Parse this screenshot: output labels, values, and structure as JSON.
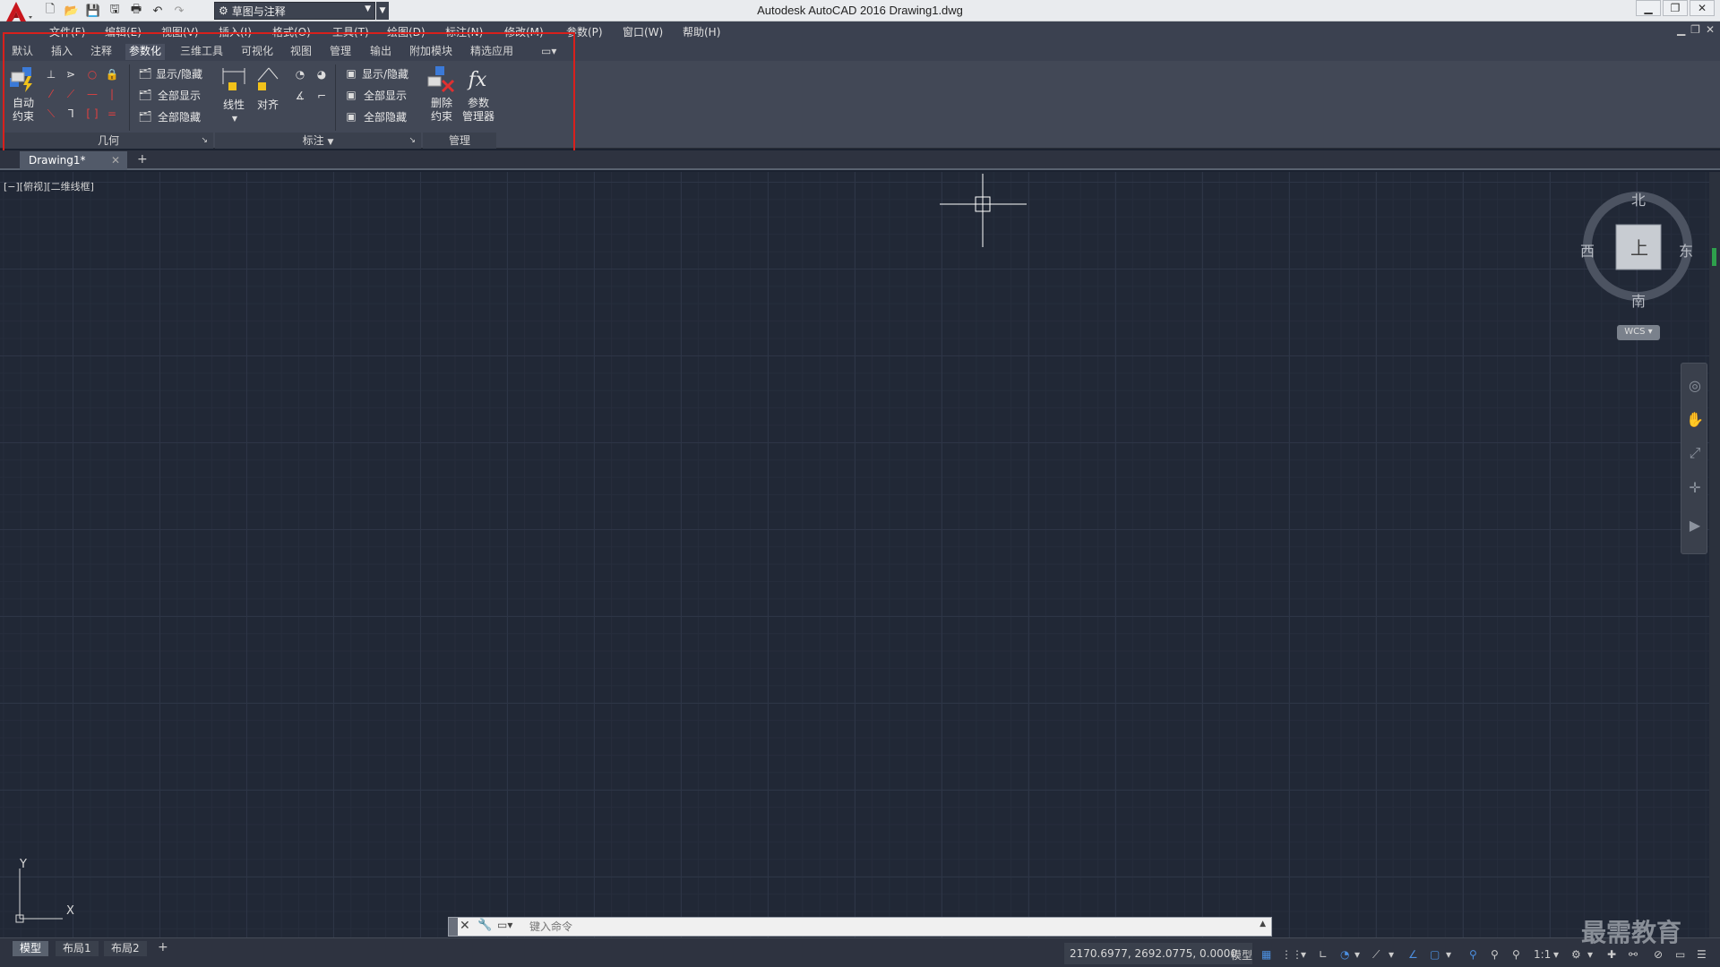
{
  "window": {
    "title": "Autodesk AutoCAD 2016    Drawing1.dwg",
    "workspace": "草图与注释"
  },
  "menu": [
    "文件(F)",
    "编辑(E)",
    "视图(V)",
    "插入(I)",
    "格式(O)",
    "工具(T)",
    "绘图(D)",
    "标注(N)",
    "修改(M)",
    "参数(P)",
    "窗口(W)",
    "帮助(H)"
  ],
  "ribbon_tabs": [
    "默认",
    "插入",
    "注释",
    "参数化",
    "三维工具",
    "可视化",
    "视图",
    "管理",
    "输出",
    "附加模块",
    "精选应用"
  ],
  "active_tab": "参数化",
  "ribbon": {
    "geometry": {
      "title": "几何",
      "auto_constrain_line1": "自动",
      "auto_constrain_line2": "约束",
      "show_hide": "显示/隐藏",
      "show_all": "全部显示",
      "hide_all": "全部隐藏"
    },
    "dimensional": {
      "title": "标注",
      "linear": "线性",
      "aligned": "对齐",
      "show_hide": "显示/隐藏",
      "show_all": "全部显示",
      "hide_all": "全部隐藏"
    },
    "manage": {
      "title": "管理",
      "delete_line1": "删除",
      "delete_line2": "约束",
      "params_line1": "参数",
      "params_line2": "管理器"
    }
  },
  "file_tab": "Drawing1*",
  "viewport_label": "[−][俯视][二维线框]",
  "viewcube": {
    "north": "北",
    "south": "南",
    "east": "东",
    "west": "西",
    "face": "上",
    "wcs": "WCS"
  },
  "ucs": {
    "x": "X",
    "y": "Y"
  },
  "command": {
    "placeholder": "键入命令"
  },
  "layout_tabs": [
    "模型",
    "布局1",
    "布局2"
  ],
  "status": {
    "coordinates": "2170.6977, 2692.0775, 0.0000",
    "model": "模型",
    "scale": "1:1"
  },
  "watermark": "最需教育",
  "colors": {
    "accent_red": "#d9201c",
    "canvas": "#212836",
    "ribbon": "#424856"
  }
}
